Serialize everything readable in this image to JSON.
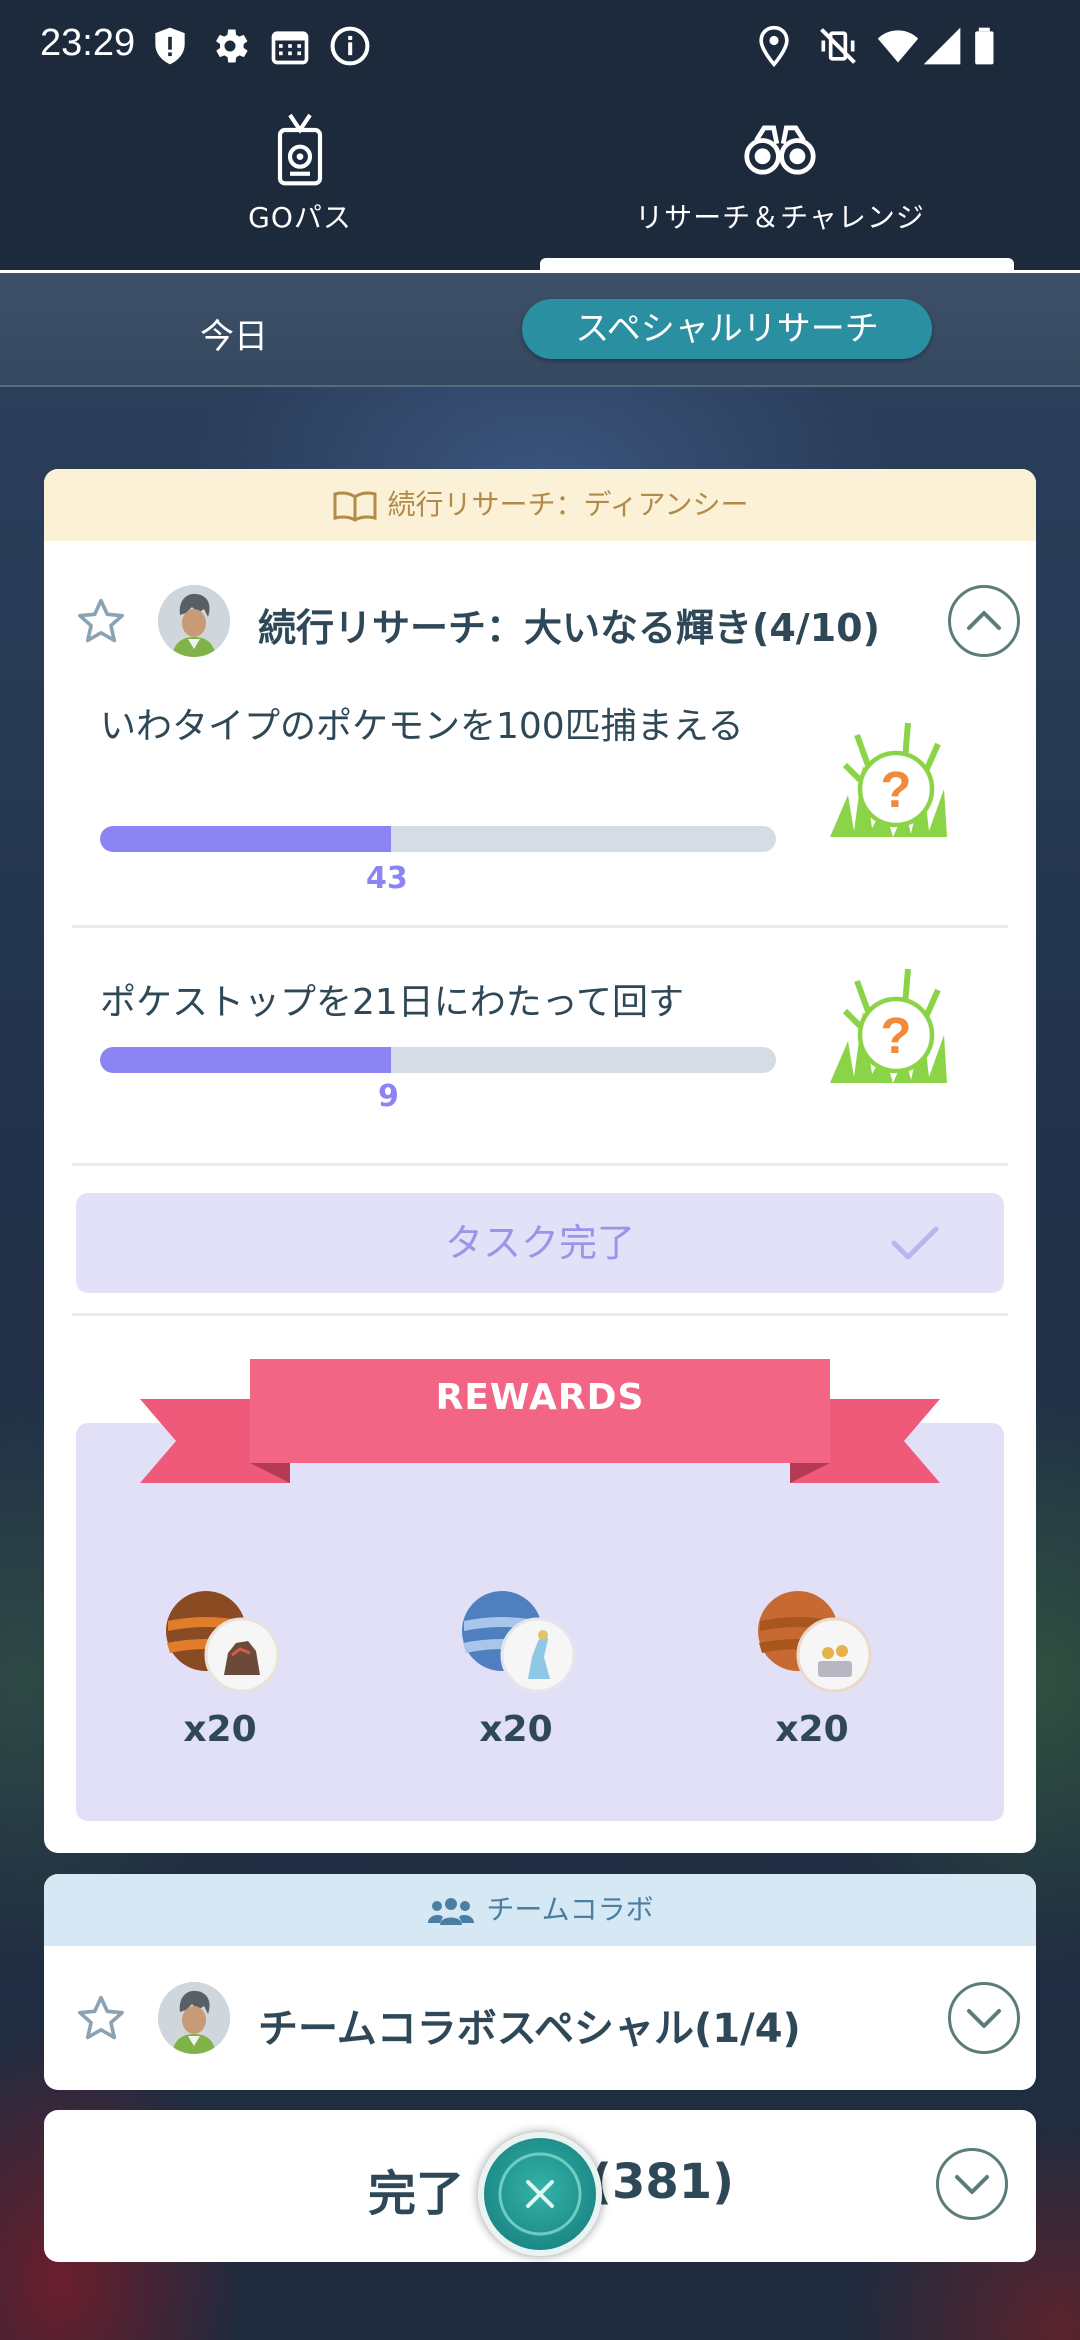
{
  "status_bar": {
    "time": "23:29",
    "icons_left": [
      "shield-alert-icon",
      "gear-icon",
      "calendar-icon",
      "info-icon"
    ],
    "icons_right": [
      "location-icon",
      "vibrate-off-icon",
      "wifi-icon",
      "signal-icon",
      "battery-icon"
    ]
  },
  "top_nav": {
    "tabs": [
      {
        "label": "GOパス",
        "icon": "go-pass-icon",
        "active": false
      },
      {
        "label": "リサーチ＆チャレンジ",
        "icon": "binoculars-icon",
        "active": true
      }
    ]
  },
  "sub_tabs": {
    "today": "今日",
    "special": "スペシャルリサーチ"
  },
  "research_card": {
    "header": "続行リサーチ：ディアンシー",
    "title": "続行リサーチ：大いなる輝き(4/10)",
    "tasks": [
      {
        "text": "いわタイプのポケモンを100匹捕まえる",
        "progress_value": "43",
        "progress_fraction": 0.43
      },
      {
        "text": "ポケストップを21日にわたって回す",
        "progress_value": "9",
        "progress_fraction": 0.43
      }
    ],
    "complete_label": "タスク完了",
    "rewards_label": "REWARDS",
    "rewards": [
      {
        "qty": "x20",
        "ball_color": "#8a4a22",
        "stripe_color": "#e07c2a"
      },
      {
        "qty": "x20",
        "ball_color": "#4f7fbf",
        "stripe_color": "#a9c6ea"
      },
      {
        "qty": "x20",
        "ball_color": "#c76a32",
        "stripe_color": "#a8561e"
      }
    ]
  },
  "team_card": {
    "header": "チームコラボ",
    "title": "チームコラボスペシャル(1/4)"
  },
  "completed_card": {
    "title_prefix": "完了",
    "count": "(381)"
  },
  "colors": {
    "accent_teal": "#2a8fa0",
    "progress_purple": "#8b84f2",
    "ribbon_pink": "#ef5a7a",
    "text_dark": "#2f4858"
  }
}
